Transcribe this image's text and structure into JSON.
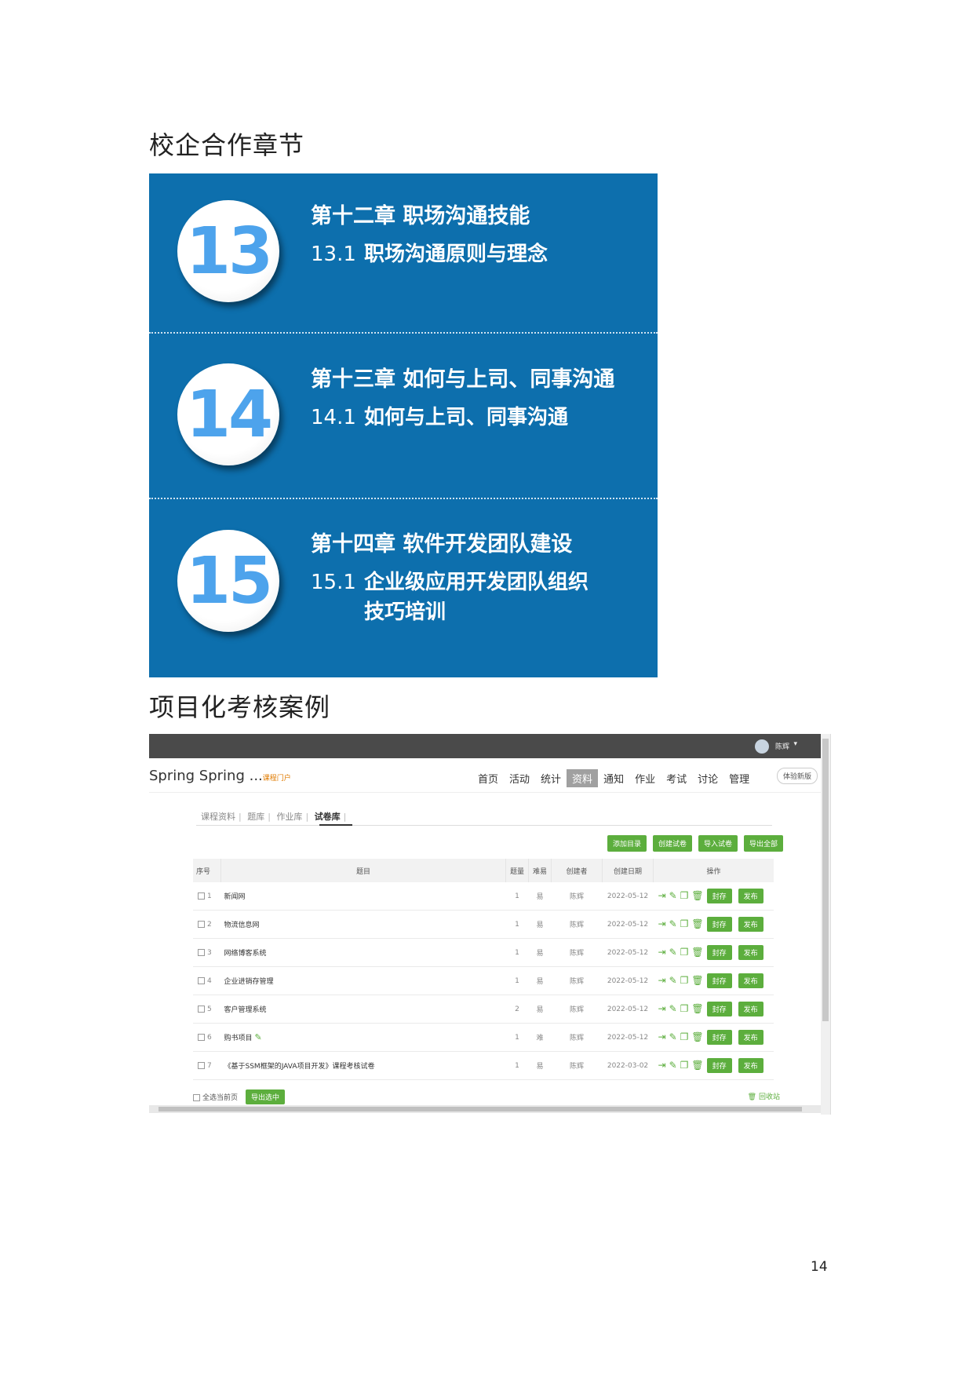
{
  "section1_title": "校企合作章节",
  "chapters": [
    {
      "number": "13",
      "title": "第十二章 职场沟通技能",
      "sub_num": "13.1",
      "sub_title": "职场沟通原则与理念",
      "sub_title2": ""
    },
    {
      "number": "14",
      "title": "第十三章 如何与上司、同事沟通",
      "sub_num": "14.1",
      "sub_title": "如何与上司、同事沟通",
      "sub_title2": ""
    },
    {
      "number": "15",
      "title": "第十四章 软件开发团队建设",
      "sub_num": "15.1",
      "sub_title": "企业级应用开发团队组织",
      "sub_title2": "技巧培训"
    }
  ],
  "section2_title": "项目化考核案例",
  "app": {
    "user": "陈辉",
    "brand": "Spring Spring ...",
    "brand_tag": "课程门户",
    "nav": [
      "首页",
      "活动",
      "统计",
      "资料",
      "通知",
      "作业",
      "考试",
      "讨论",
      "管理"
    ],
    "nav_active": "资料",
    "new_version": "体验新版",
    "tabs": [
      "课程资料",
      "题库",
      "作业库",
      "试卷库"
    ],
    "tab_active": "试卷库",
    "actions": [
      "添加目录",
      "创建试卷",
      "导入试卷",
      "导出全部"
    ],
    "columns": [
      "序号",
      "题目",
      "题量",
      "难易",
      "创建者",
      "创建日期",
      "操作"
    ],
    "rows": [
      {
        "idx": "1",
        "title": "新闻网",
        "count": "1",
        "level": "易",
        "creator": "陈辉",
        "date": "2022-05-12",
        "editable": false
      },
      {
        "idx": "2",
        "title": "物流信息网",
        "count": "1",
        "level": "易",
        "creator": "陈辉",
        "date": "2022-05-12",
        "editable": false
      },
      {
        "idx": "3",
        "title": "网络博客系统",
        "count": "1",
        "level": "易",
        "creator": "陈辉",
        "date": "2022-05-12",
        "editable": false
      },
      {
        "idx": "4",
        "title": "企业进销存管理",
        "count": "1",
        "level": "易",
        "creator": "陈辉",
        "date": "2022-05-12",
        "editable": false
      },
      {
        "idx": "5",
        "title": "客户管理系统",
        "count": "2",
        "level": "易",
        "creator": "陈辉",
        "date": "2022-05-12",
        "editable": false
      },
      {
        "idx": "6",
        "title": "购书项目",
        "count": "1",
        "level": "难",
        "creator": "陈辉",
        "date": "2022-05-12",
        "editable": true
      },
      {
        "idx": "7",
        "title": "《基于SSM框架的JAVA项目开发》课程考核试卷",
        "count": "1",
        "level": "易",
        "creator": "陈辉",
        "date": "2022-03-02",
        "editable": false
      }
    ],
    "row_btn_archive": "封存",
    "row_btn_publish": "发布",
    "select_page": "全选当前页",
    "export_selected": "导出选中",
    "recycle": "回收站",
    "accent_color": "#5cae3d"
  },
  "page_number": "14"
}
